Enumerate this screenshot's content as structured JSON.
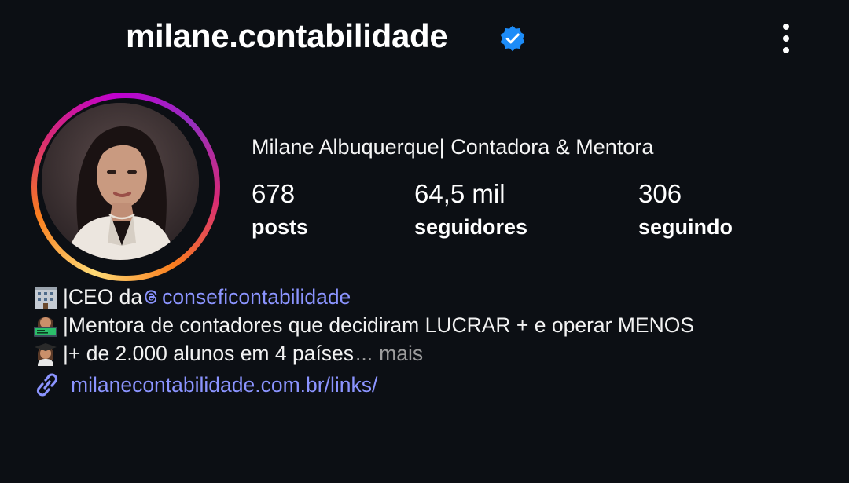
{
  "header": {
    "username": "milane.contabilidade",
    "verified_icon": "verified-badge-icon",
    "menu_icon": "more-options-icon"
  },
  "profile": {
    "display_name": "Milane Albuquerque| Contadora & Mentora",
    "avatar_icon": "profile-photo"
  },
  "stats": [
    {
      "value": "678",
      "label": "posts"
    },
    {
      "value": "64,5 mil",
      "label": "seguidores"
    },
    {
      "value": "306",
      "label": "seguindo"
    }
  ],
  "bio": {
    "line1_prefix": "|CEO da ",
    "line1_mention": "conseficontabilidade",
    "line2": "|Mentora de contadores que decidiram LUCRAR + e operar MENOS",
    "line3": "|+ de 2.000 alunos em 4 países",
    "ellipsis": "...",
    "more": "mais",
    "link": "milanecontabilidade.com.br/links/"
  },
  "colors": {
    "background": "#0c0f14",
    "link": "#8b94ff",
    "verified": "#1d8cf8",
    "muted": "#9c9c9c"
  }
}
